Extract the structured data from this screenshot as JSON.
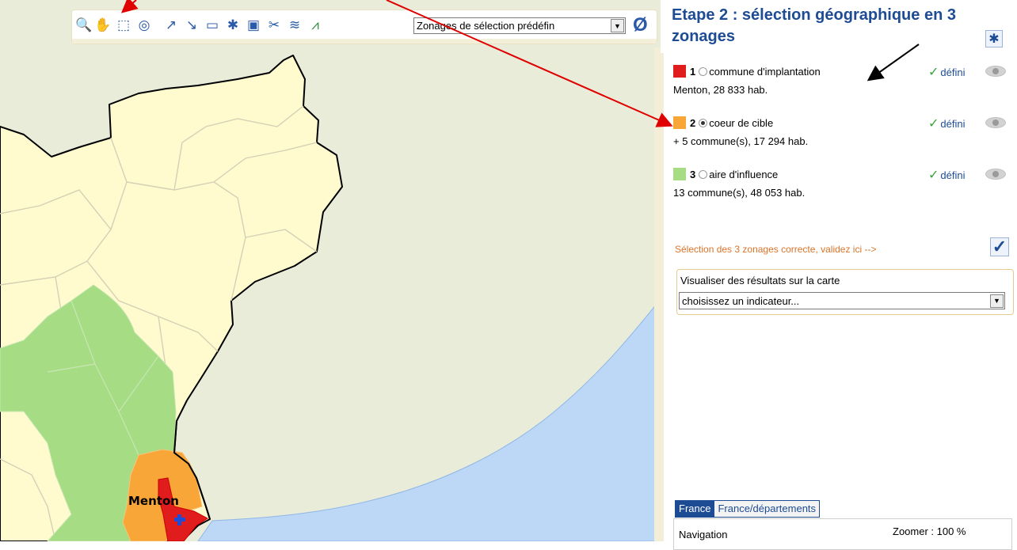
{
  "toolbar": {
    "icons": [
      "zoom-icon",
      "pan-hand-icon",
      "select-rectangle-icon",
      "binoculars-icon",
      "draw-line-icon",
      "draw-segment-icon",
      "open-folder-icon",
      "puzzle-icon",
      "save-icon",
      "tools-icon",
      "water-icon",
      "road-icon"
    ],
    "preset_select": "Zonages de sélection prédéfin",
    "clear_symbol": "Ø"
  },
  "map": {
    "label": "Menton",
    "colors": {
      "land": "#fffbcf",
      "neighbor": "#e8ecd9",
      "sea": "#bdd8f7",
      "zone1": "#e11c1c",
      "zone2": "#f8a637",
      "zone3": "#a6dc84"
    }
  },
  "panel": {
    "title": "Etape 2 : sélection géographique en 3 zonages",
    "zones": [
      {
        "num": "1",
        "name": "commune d'implantation",
        "status": "défini",
        "detail": "Menton, 28 833 hab.",
        "color": "#e11c1c",
        "selected": false
      },
      {
        "num": "2",
        "name": "coeur de cible",
        "status": "défini",
        "detail": "+ 5 commune(s), 17 294 hab.",
        "color": "#f8a637",
        "selected": true
      },
      {
        "num": "3",
        "name": "aire d'influence",
        "status": "défini",
        "detail": "13 commune(s), 48 053 hab.",
        "color": "#a6dc84",
        "selected": false
      }
    ],
    "validate_text": "Sélection des 3 zonages correcte, validez ici -->",
    "indicator": {
      "label": "Visualiser des résultats sur la carte",
      "select": "choisissez un indicateur..."
    },
    "tabs": [
      "France",
      "France/départements"
    ],
    "navigation": {
      "label": "Navigation",
      "zoom": "Zoomer : 100 %"
    }
  },
  "accent_colors": {
    "title_blue": "#1d4c95",
    "check_green": "#3aa23a",
    "validate_orange": "#d8742a",
    "annotation_red": "#e00000"
  }
}
